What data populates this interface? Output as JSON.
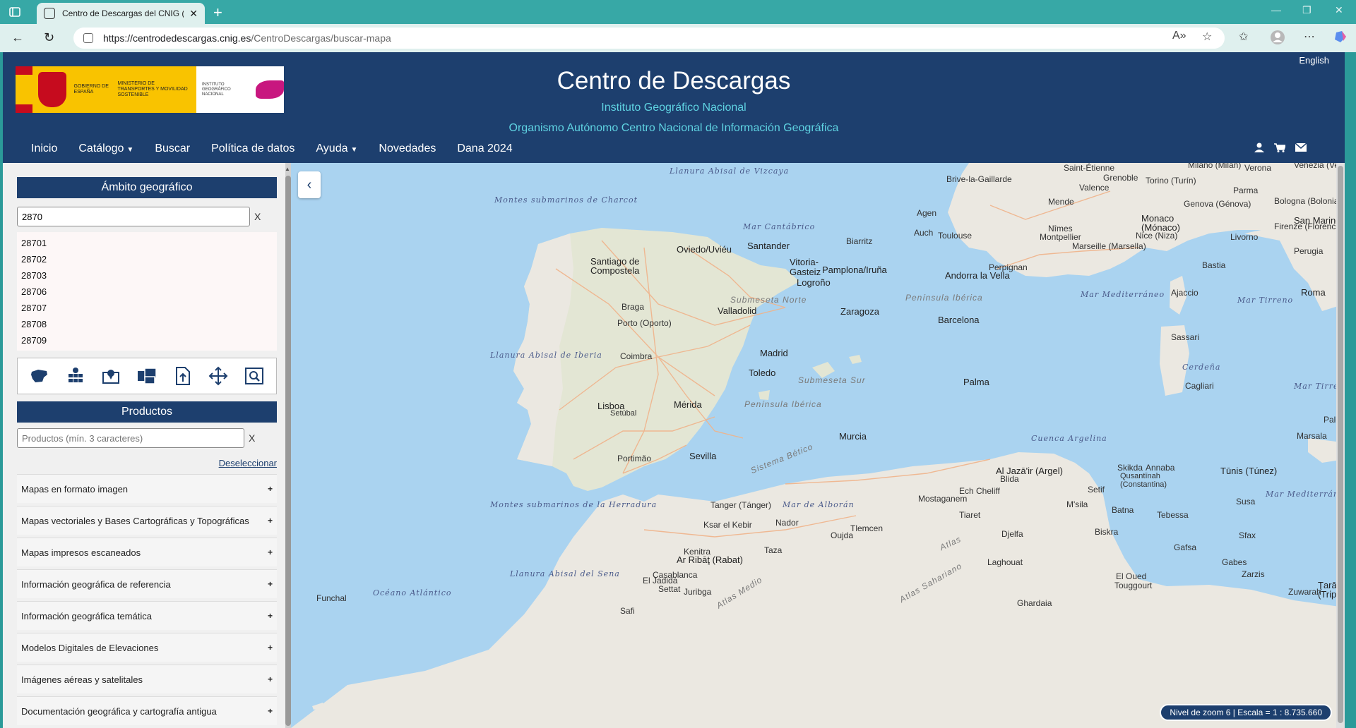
{
  "browser": {
    "tab_title": "Centro de Descargas del CNIG (IG",
    "url_host": "https://centrodedescargas.cnig.es",
    "url_path": "/CentroDescargas/buscar-mapa"
  },
  "header": {
    "language": "English",
    "title": "Centro de Descargas",
    "subtitle1": "Instituto Geográfico Nacional",
    "subtitle2": "Organismo Autónomo Centro Nacional de Información Geográfica",
    "logo": {
      "gov_text": "GOBIERNO DE ESPAÑA",
      "ministry_text": "MINISTERIO DE TRANSPORTES Y MOVILIDAD SOSTENIBLE",
      "ign_text": "INSTITUTO GEOGRÁFICO NACIONAL"
    },
    "menu": [
      {
        "label": "Inicio",
        "caret": ""
      },
      {
        "label": "Catálogo",
        "caret": "▼"
      },
      {
        "label": "Buscar",
        "caret": ""
      },
      {
        "label": "Política de datos",
        "caret": ""
      },
      {
        "label": "Ayuda",
        "caret": "▼"
      },
      {
        "label": "Novedades",
        "caret": ""
      },
      {
        "label": "Dana 2024",
        "caret": ""
      }
    ]
  },
  "sidebar": {
    "geo_title": "Ámbito geográfico",
    "geo_search_value": "2870",
    "clear_label": "X",
    "codes": [
      "28701",
      "28702",
      "28703",
      "28706",
      "28707",
      "28708",
      "28709"
    ],
    "products_title": "Productos",
    "products_placeholder": "Productos (mín. 3 caracteres)",
    "deselect_label": "Deseleccionar",
    "categories": [
      "Mapas en formato imagen",
      "Mapas vectoriales y Bases Cartográficas y Topográficas",
      "Mapas impresos escaneados",
      "Información geográfica de referencia",
      "Información geográfica temática",
      "Modelos Digitales de Elevaciones",
      "Imágenes aéreas y satelitales",
      "Documentación geográfica y cartografía antigua"
    ]
  },
  "map": {
    "status": "Nivel de zoom 6 | Escala = 1 : 8.735.660",
    "labels": {
      "vizcaya": "Llanura Abisal de Vizcaya",
      "charcot": "Montes submarinos de Charcot",
      "cantabrico": "Mar Cantábrico",
      "iberia_abisal": "Llanura Abisal de Iberia",
      "herradura": "Montes submarinos de la Herradura",
      "sena": "Llanura Abisal del Sena",
      "atlantico": "Océano Atlántico",
      "alboran": "Mar de Alborán",
      "mediterraneo1": "Mar Mediterráneo",
      "mediterraneo2": "Mar Mediterráneo",
      "tirreno1": "Mar Tirreno",
      "tirreno2": "Mar Tirren",
      "cerdena": "Cerdeña",
      "argelina": "Cuenca Argelina",
      "meseta_norte": "Submeseta Norte",
      "meseta_sur": "Submeseta Sur",
      "peninsula": "Península Ibérica",
      "peninsula2": "Península Ibérica",
      "betico": "Sistema Bético",
      "atlas": "Atlas",
      "atlas_medio": "Atlas Medio",
      "atlas_sahariano": "Atlas Sahariano",
      "santiago": "Santiago de Compostela",
      "oviedo": "Oviedo/Uviéu",
      "santander": "Santander",
      "vitoria": "Vitoria-Gasteiz",
      "pamplona": "Pamplona/Iruña",
      "logrono": "Logroño",
      "valladolid": "Valladolid",
      "zaragoza": "Zaragoza",
      "barcelona": "Barcelona",
      "andorra": "Andorra la Vella",
      "madrid": "Madrid",
      "toledo": "Toledo",
      "merida": "Mérida",
      "sevilla": "Sevilla",
      "murcia": "Murcia",
      "palma": "Palma",
      "lisboa": "Lisboa",
      "setubal": "Setúbal",
      "coimbra": "Coimbra",
      "braga": "Braga",
      "porto": "Porto (Oporto)",
      "portimao": "Portimão",
      "tanger": "Tanger (Tánger)",
      "rabat": "Ar Ribāţ (Rabat)",
      "kenitra": "Kenitra",
      "casablanca": "Casablanca",
      "argel": "Al Jazā'ir (Argel)",
      "tunis": "Tūnis (Túnez)",
      "roma": "Roma",
      "bordeaux": "Brive-la-Gaillarde",
      "toulouse": "Toulouse",
      "marseille": "Marseille (Marsella)",
      "monaco": "Monaco (Mónaco)",
      "nimes": "Nîmes",
      "montpellier": "Montpellier",
      "perpignan": "Perpignan",
      "biarritz": "Biarritz",
      "agen": "Agen",
      "auch": "Auch",
      "mende": "Mende",
      "valence": "Valence",
      "grenoble": "Grenoble",
      "saint_etienne": "Saint-Étienne",
      "torino": "Torino (Turín)",
      "milano": "Milano (Milán)",
      "verona": "Verona",
      "venezia": "Venezia (Venec",
      "genova": "Genova (Génova)",
      "parma": "Parma",
      "bologna": "Bologna (Bolonia)",
      "firenze": "Firenze (Florencia)",
      "san_marino": "San Marino",
      "livorno": "Livorno",
      "perugia": "Perugia",
      "bastia": "Bastia",
      "ajaccio": "Ajaccio",
      "sassari": "Sassari",
      "cagliari": "Cagliari",
      "nice": "Nice (Niza)",
      "marsala": "Marsala",
      "palermo": "Palerm",
      "skikda": "Skikda",
      "annaba": "Annaba",
      "constantine": "Qusantīnah (Constantina)",
      "setif": "Setif",
      "blida": "Blida",
      "ech_cheliff": "Ech Cheliff",
      "mostaganem": "Mostaganem",
      "tiaret": "Tiaret",
      "msila": "M'sila",
      "batna": "Batna",
      "tebessa": "Tebessa",
      "biskra": "Biskra",
      "sfax": "Sfax",
      "susa": "Susa",
      "gafsa": "Gafsa",
      "gabes": "Gabes",
      "zarzis": "Zarzis",
      "zuwarah": "Zuwarah",
      "tarabulus": "Ţarābu (Tripol",
      "nador": "Nador",
      "oujda": "Oujda",
      "tlemcen": "Tlemcen",
      "ksar": "Ksar el Kebir",
      "taza": "Taza",
      "djelfa": "Djelfa",
      "laghouat": "Laghouat",
      "el_oued": "El Oued",
      "touggourt": "Touggourt",
      "ghardaia": "Ghardaia",
      "el_jadida": "El Jadida",
      "settat": "Settat",
      "juribga": "Juribga",
      "safi": "Safi",
      "funchal": "Funchal"
    }
  }
}
